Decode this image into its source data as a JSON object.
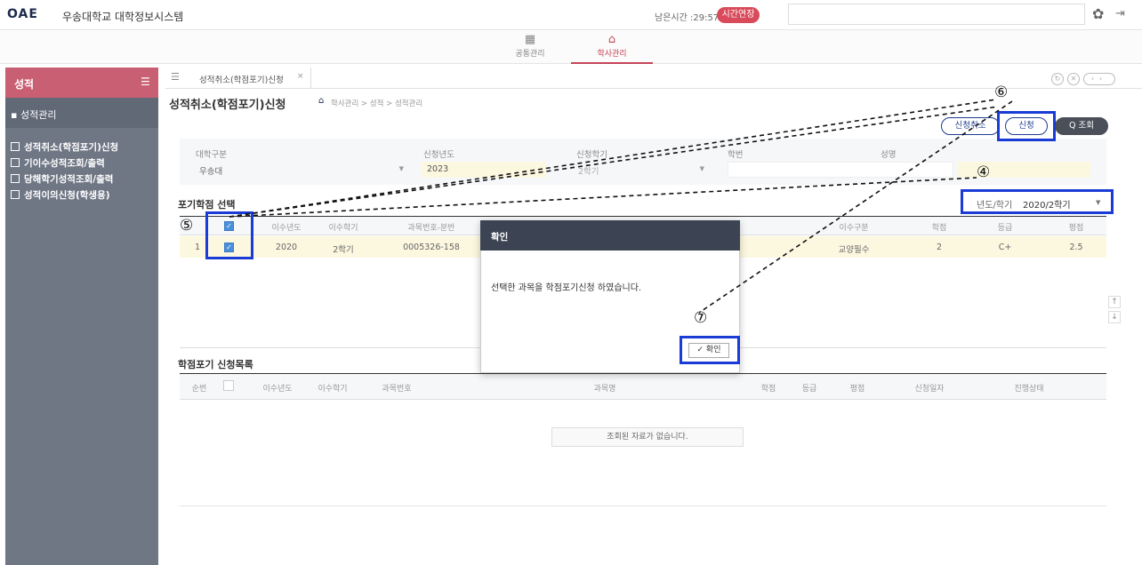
{
  "app": {
    "logo": "OAE",
    "title": "우송대학교 대학정보시스템",
    "time_left": "남은시간 :29:57",
    "extend_label": "시간연장"
  },
  "topmenu": [
    {
      "label": "공통관리",
      "icon": "grid-icon"
    },
    {
      "label": "학사관리",
      "icon": "graduation-cap-icon"
    }
  ],
  "sidebar": {
    "title": "성적",
    "group": "성적관리",
    "items": [
      "성적취소(학점포기)신청",
      "기이수성적조회/출력",
      "당해학기성적조회/출력",
      "성적이의신청(학생용)"
    ]
  },
  "tab": {
    "label": "성적취소(학점포기)신청",
    "close": "×"
  },
  "page": {
    "title": "성적취소(학점포기)신청",
    "breadcrumb": "학사관리 > 성적 > 성적관리",
    "buttons": {
      "cancel": "신청취소",
      "apply": "신청",
      "query": "Q 조회"
    }
  },
  "filter": {
    "univ_label": "대학구분",
    "univ_value": "우송대",
    "year_label": "신청년도",
    "year_value": "2023",
    "term_label": "신청학기",
    "term_value": "2학기",
    "stno_label": "학번",
    "stno_value": "",
    "name_label": "성명",
    "name_value": ""
  },
  "section1": {
    "title": "포기학점 선택",
    "year_term_label": "년도/학기",
    "year_term_value": "2020/2학기",
    "columns": [
      "이수년도",
      "이수학기",
      "과목번호-분반",
      "이수구분",
      "학점",
      "등급",
      "평점"
    ],
    "rows": [
      {
        "no": "1",
        "year": "2020",
        "term": "2학기",
        "code": "0005326-158",
        "type": "교양필수",
        "credit": "2",
        "grade": "C+",
        "score": "2.5"
      }
    ]
  },
  "section2": {
    "title": "학점포기 신청목록",
    "columns": [
      "순번",
      "이수년도",
      "이수학기",
      "과목번호",
      "과목명",
      "학점",
      "등급",
      "평점",
      "신청일자",
      "진행상태"
    ],
    "empty_message": "조회된 자료가 없습니다."
  },
  "modal": {
    "title": "확인",
    "message": "선택한 과목을 학점포기신청 하였습니다.",
    "ok_label": "✓ 확인"
  },
  "annotations": {
    "n4": "④",
    "n5": "⑤",
    "n6": "⑥",
    "n7": "⑦"
  },
  "colors": {
    "sidebar_head": "#c95f72",
    "sidebar": "#6f7785",
    "highlight": "#1a3bd6",
    "modal_head": "#3c4454"
  }
}
